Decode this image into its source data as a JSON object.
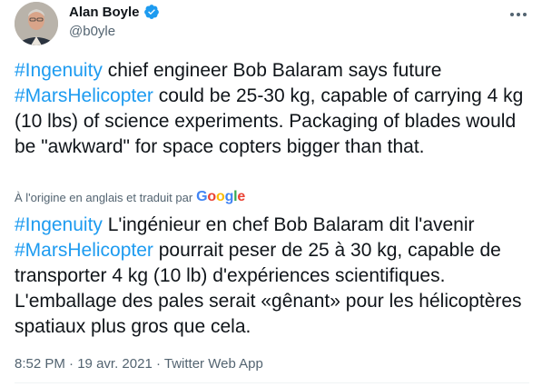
{
  "author": {
    "name": "Alan Boyle",
    "handle": "@b0yle",
    "avatar_icon": "person-avatar",
    "verified_icon": "verified-badge-icon",
    "verified_color": "#1d9bf0"
  },
  "more_icon": "more-options-icon",
  "tweet": {
    "original": [
      {
        "text": "#Ingenuity",
        "hashtag": true
      },
      {
        "text": " chief engineer Bob Balaram says future ",
        "hashtag": false
      },
      {
        "text": "#MarsHelicopter",
        "hashtag": true
      },
      {
        "text": " could be 25-30 kg, capable of carrying 4 kg (10 lbs) of science experiments. Packaging of blades would be \"awkward\" for space copters bigger than that.",
        "hashtag": false
      }
    ],
    "translation_note": "À l'origine en anglais et traduit par",
    "translation_provider": "Google",
    "translated": [
      {
        "text": "#Ingenuity",
        "hashtag": true
      },
      {
        "text": " L'ingénieur en chef Bob Balaram dit l'avenir ",
        "hashtag": false
      },
      {
        "text": "#MarsHelicopter",
        "hashtag": true
      },
      {
        "text": " pourrait peser de 25 à 30 kg, capable de transporter 4 kg (10 lb) d'expériences scientifiques. L'emballage des pales serait «gênant» pour les hélicoptères spatiaux plus gros que cela.",
        "hashtag": false
      }
    ],
    "time": "8:52 PM",
    "separator": "·",
    "date": "19 avr. 2021",
    "source": "Twitter Web App"
  },
  "colors": {
    "link": "#1d9bf0",
    "text": "#0f1419",
    "secondary": "#536471"
  }
}
